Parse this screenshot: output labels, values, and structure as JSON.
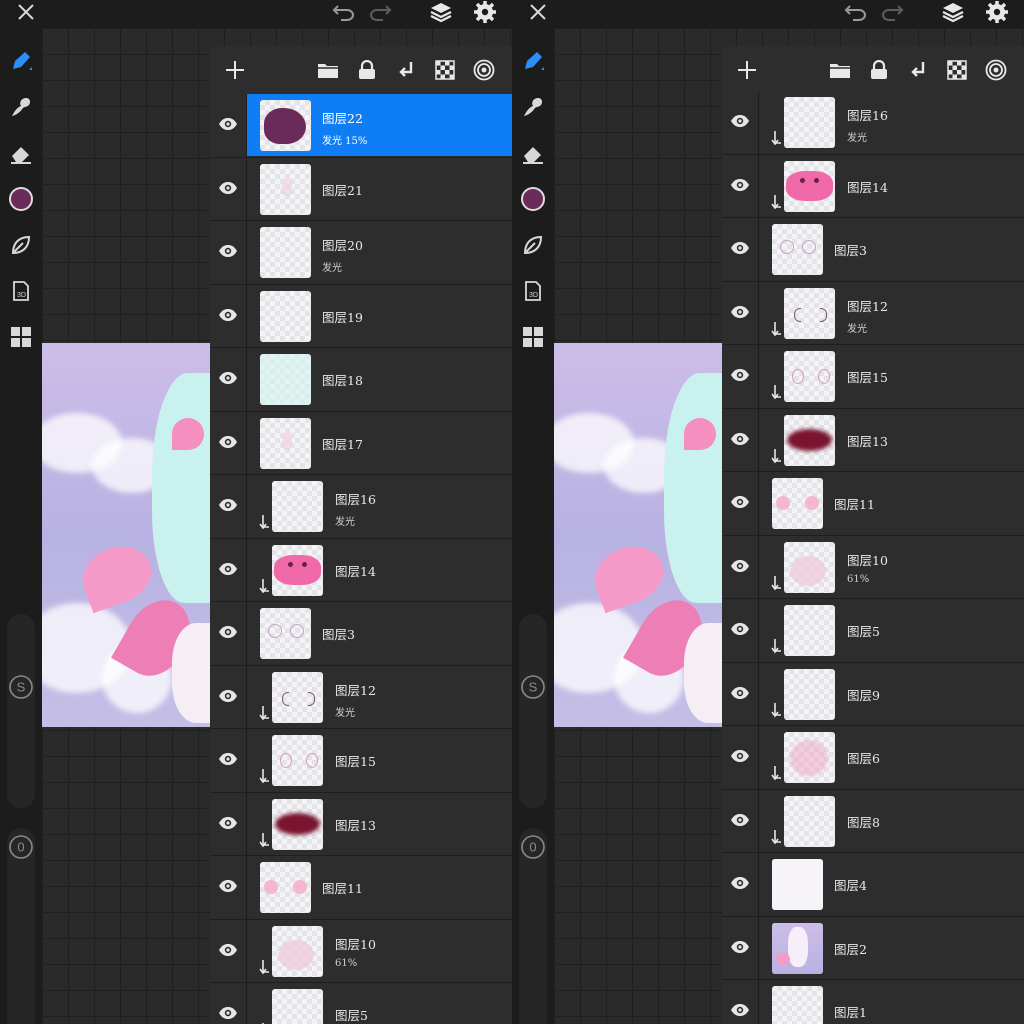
{
  "colors": {
    "accent": "#0f7df5",
    "current_color": "#6a2a5a",
    "background": "#1c1c1c",
    "panel": "#2d2d2d"
  },
  "icons": {
    "close": "close-icon",
    "undo": "undo-icon",
    "redo": "redo-icon",
    "layers": "layers-icon",
    "settings": "gear-icon",
    "brush": "brush-icon",
    "smudge": "smudge-icon",
    "eraser": "eraser-icon",
    "leaf": "leaf-icon",
    "model3d": "3d-model-icon",
    "grid": "grid-icon",
    "add": "plus-icon",
    "folder": "folder-icon",
    "lock": "lock-icon",
    "merge": "merge-down-icon",
    "alpha": "checkerboard-icon",
    "target": "reference-icon",
    "eye": "eye-icon"
  },
  "left_toolbar": {
    "size_label": "S",
    "opacity_label": "0",
    "model_label": "3D"
  },
  "left_layers": [
    {
      "name": "图层22",
      "sub": "发光  15%",
      "selected": true,
      "indent": false,
      "thumb": "purple-blob"
    },
    {
      "name": "图层21",
      "sub": "",
      "indent": false,
      "thumb": "faint"
    },
    {
      "name": "图层20",
      "sub": "发光",
      "indent": false,
      "thumb": "empty"
    },
    {
      "name": "图层19",
      "sub": "",
      "indent": false,
      "thumb": "empty"
    },
    {
      "name": "图层18",
      "sub": "",
      "indent": false,
      "thumb": "mint"
    },
    {
      "name": "图层17",
      "sub": "",
      "indent": false,
      "thumb": "faint"
    },
    {
      "name": "图层16",
      "sub": "发光",
      "indent": true,
      "thumb": "empty"
    },
    {
      "name": "图层14",
      "sub": "",
      "indent": true,
      "thumb": "pink-face"
    },
    {
      "name": "图层3",
      "sub": "",
      "indent": false,
      "thumb": "eyes-sketch"
    },
    {
      "name": "图层12",
      "sub": "发光",
      "indent": true,
      "thumb": "brackets"
    },
    {
      "name": "图层15",
      "sub": "",
      "indent": true,
      "thumb": "eye-dots"
    },
    {
      "name": "图层13",
      "sub": "",
      "indent": true,
      "thumb": "dark-red"
    },
    {
      "name": "图层11",
      "sub": "",
      "indent": false,
      "thumb": "blush"
    },
    {
      "name": "图层10",
      "sub": "61%",
      "indent": true,
      "thumb": "soft-pink"
    },
    {
      "name": "图层5",
      "sub": "",
      "indent": true,
      "thumb": "empty"
    }
  ],
  "right_layers": [
    {
      "name": "图层16",
      "sub": "发光",
      "indent": true,
      "thumb": "empty"
    },
    {
      "name": "图层14",
      "sub": "",
      "indent": true,
      "thumb": "pink-face"
    },
    {
      "name": "图层3",
      "sub": "",
      "indent": false,
      "thumb": "eyes-sketch"
    },
    {
      "name": "图层12",
      "sub": "发光",
      "indent": true,
      "thumb": "brackets"
    },
    {
      "name": "图层15",
      "sub": "",
      "indent": true,
      "thumb": "eye-dots"
    },
    {
      "name": "图层13",
      "sub": "",
      "indent": true,
      "thumb": "dark-red"
    },
    {
      "name": "图层11",
      "sub": "",
      "indent": false,
      "thumb": "blush"
    },
    {
      "name": "图层10",
      "sub": "61%",
      "indent": true,
      "thumb": "soft-pink"
    },
    {
      "name": "图层5",
      "sub": "",
      "indent": true,
      "thumb": "empty"
    },
    {
      "name": "图层9",
      "sub": "",
      "indent": true,
      "thumb": "empty"
    },
    {
      "name": "图层6",
      "sub": "",
      "indent": true,
      "thumb": "pink-dots"
    },
    {
      "name": "图层8",
      "sub": "",
      "indent": true,
      "thumb": "empty"
    },
    {
      "name": "图层4",
      "sub": "",
      "indent": false,
      "thumb": "white"
    },
    {
      "name": "图层2",
      "sub": "",
      "indent": false,
      "thumb": "artwork"
    },
    {
      "name": "图层1",
      "sub": "",
      "indent": false,
      "thumb": "empty"
    }
  ]
}
